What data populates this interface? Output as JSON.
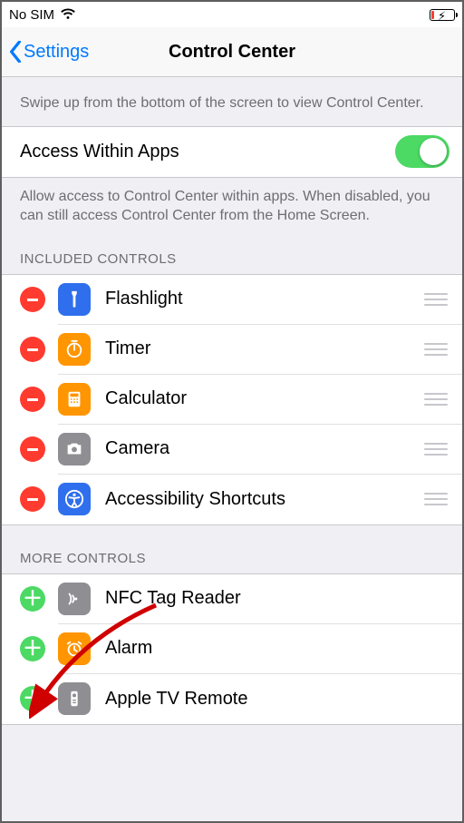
{
  "status": {
    "carrier": "No SIM"
  },
  "nav": {
    "back": "Settings",
    "title": "Control Center"
  },
  "intro": "Swipe up from the bottom of the screen to view Control Center.",
  "access": {
    "label": "Access Within Apps",
    "footer": "Allow access to Control Center within apps. When disabled, you can still access Control Center from the Home Screen.",
    "on": true
  },
  "included": {
    "header": "INCLUDED CONTROLS",
    "items": [
      {
        "label": "Flashlight",
        "icon": "flashlight",
        "bg": "#2f6fed"
      },
      {
        "label": "Timer",
        "icon": "timer",
        "bg": "#ff9500"
      },
      {
        "label": "Calculator",
        "icon": "calculator",
        "bg": "#ff9500"
      },
      {
        "label": "Camera",
        "icon": "camera",
        "bg": "#8e8e93"
      },
      {
        "label": "Accessibility Shortcuts",
        "icon": "accessibility",
        "bg": "#2f6fed"
      }
    ]
  },
  "more": {
    "header": "MORE CONTROLS",
    "items": [
      {
        "label": "NFC Tag Reader",
        "icon": "nfc",
        "bg": "#8e8e93"
      },
      {
        "label": "Alarm",
        "icon": "alarm",
        "bg": "#ff9500"
      },
      {
        "label": "Apple TV Remote",
        "icon": "remote",
        "bg": "#8e8e93"
      }
    ]
  }
}
